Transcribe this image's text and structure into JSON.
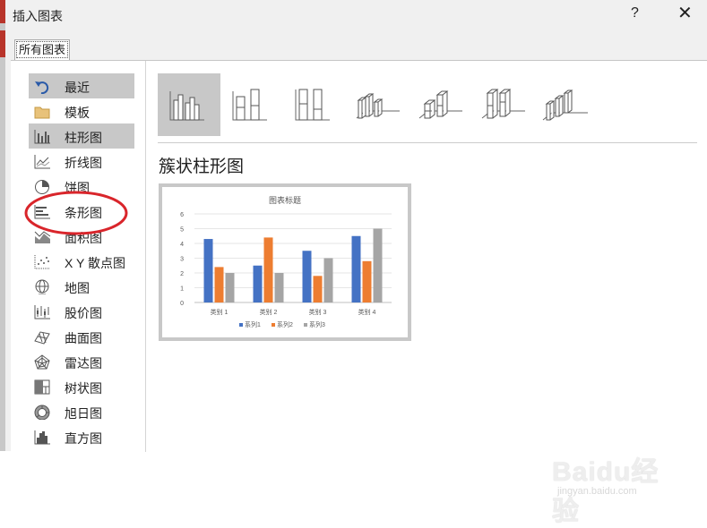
{
  "window": {
    "title": "插入图表",
    "help_label": "?",
    "close_label": "✕"
  },
  "tabs": [
    {
      "label": "所有图表"
    }
  ],
  "sidebar": {
    "items": [
      {
        "label": "最近",
        "icon": "undo-arrow-icon",
        "selected": true
      },
      {
        "label": "模板",
        "icon": "folder-icon",
        "selected": false
      },
      {
        "label": "柱形图",
        "icon": "column-chart-icon",
        "selected": true
      },
      {
        "label": "折线图",
        "icon": "line-chart-icon",
        "selected": false
      },
      {
        "label": "饼图",
        "icon": "pie-chart-icon",
        "selected": false
      },
      {
        "label": "条形图",
        "icon": "bar-chart-icon",
        "selected": false
      },
      {
        "label": "面积图",
        "icon": "area-chart-icon",
        "selected": false
      },
      {
        "label": "X Y 散点图",
        "icon": "scatter-chart-icon",
        "selected": false
      },
      {
        "label": "地图",
        "icon": "globe-map-icon",
        "selected": false
      },
      {
        "label": "股价图",
        "icon": "stock-chart-icon",
        "selected": false
      },
      {
        "label": "曲面图",
        "icon": "surface-chart-icon",
        "selected": false
      },
      {
        "label": "雷达图",
        "icon": "radar-chart-icon",
        "selected": false
      },
      {
        "label": "树状图",
        "icon": "treemap-chart-icon",
        "selected": false
      },
      {
        "label": "旭日图",
        "icon": "sunburst-chart-icon",
        "selected": false
      },
      {
        "label": "直方图",
        "icon": "histogram-chart-icon",
        "selected": false
      }
    ]
  },
  "chart_subtypes": [
    {
      "icon": "clustered-column-icon",
      "selected": true
    },
    {
      "icon": "stacked-column-icon",
      "selected": false
    },
    {
      "icon": "percent-stacked-column-icon",
      "selected": false
    },
    {
      "icon": "3d-clustered-column-icon",
      "selected": false
    },
    {
      "icon": "3d-stacked-column-icon",
      "selected": false
    },
    {
      "icon": "3d-percent-stacked-column-icon",
      "selected": false
    },
    {
      "icon": "3d-column-icon",
      "selected": false
    }
  ],
  "subtype_title": "簇状柱形图",
  "annotation": {
    "color": "#d9252b"
  },
  "colors": {
    "series1": "#4472c4",
    "series2": "#ed7d31",
    "series3": "#a5a5a5",
    "selected_bg": "#c8c8c8"
  },
  "chart_data": {
    "type": "bar",
    "title": "图表标题",
    "categories": [
      "类别 1",
      "类别 2",
      "类别 3",
      "类别 4"
    ],
    "series": [
      {
        "name": "系列1",
        "values": [
          4.3,
          2.5,
          3.5,
          4.5
        ],
        "color": "#4472c4"
      },
      {
        "name": "系列2",
        "values": [
          2.4,
          4.4,
          1.8,
          2.8
        ],
        "color": "#ed7d31"
      },
      {
        "name": "系列3",
        "values": [
          2.0,
          2.0,
          3.0,
          5.0
        ],
        "color": "#a5a5a5"
      }
    ],
    "ylim": [
      0,
      6
    ],
    "yticks": [
      "0",
      "1",
      "2",
      "3",
      "4",
      "5",
      "6"
    ],
    "grid": true,
    "legend": "bottom"
  },
  "watermark": {
    "brand": "Baidu经验",
    "url": "jingyan.baidu.com"
  }
}
